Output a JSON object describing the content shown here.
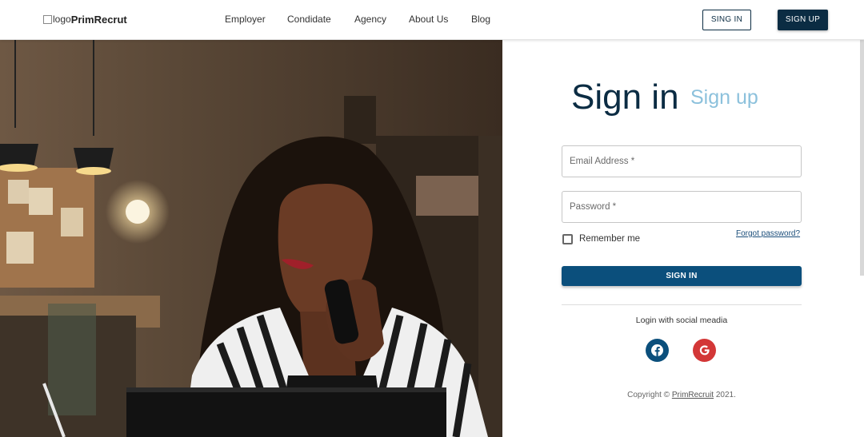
{
  "header": {
    "logo_alt": "logo",
    "logo_name": "PrimRecrut",
    "nav": [
      "Employer",
      "Condidate",
      "Agency",
      "About Us",
      "Blog"
    ],
    "signin_label": "SING IN",
    "signup_label": "SIGN UP"
  },
  "form": {
    "title": "Sign in",
    "alt_tab": "Sign up",
    "email_placeholder": "Email Address *",
    "password_placeholder": "Password *",
    "remember_label": "Remember me",
    "forgot_label": "Forgot password?",
    "submit_label": "SIGN IN",
    "social_label": "Login with social meadia"
  },
  "social": {
    "facebook_icon": "facebook-icon",
    "google_icon": "google-icon",
    "facebook_color": "#0b4f7c",
    "google_color": "#d33737"
  },
  "footer": {
    "copyright_prefix": "Copyright ©",
    "brand": "PrimRecruit",
    "year": "2021."
  },
  "colors": {
    "primary": "#0b2c43",
    "button": "#0b4f7c",
    "accent_light": "#8cc1dc"
  }
}
